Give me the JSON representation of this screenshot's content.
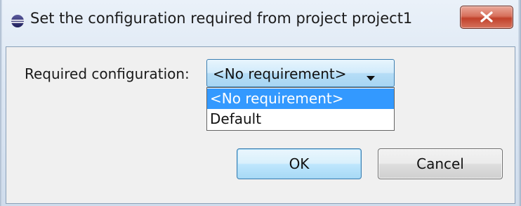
{
  "window": {
    "title": "Set the configuration required from project project1",
    "app_icon": "eclipse-sphere-icon",
    "close_icon": "close-x-icon"
  },
  "form": {
    "required_label": "Required configuration:",
    "combo": {
      "value": "<No requirement>",
      "options": [
        "<No requirement>",
        "Default"
      ],
      "selected_index": 0
    }
  },
  "buttons": {
    "ok": "OK",
    "cancel": "Cancel"
  },
  "colors": {
    "selection": "#3399ff",
    "close_button": "#c1412b"
  }
}
